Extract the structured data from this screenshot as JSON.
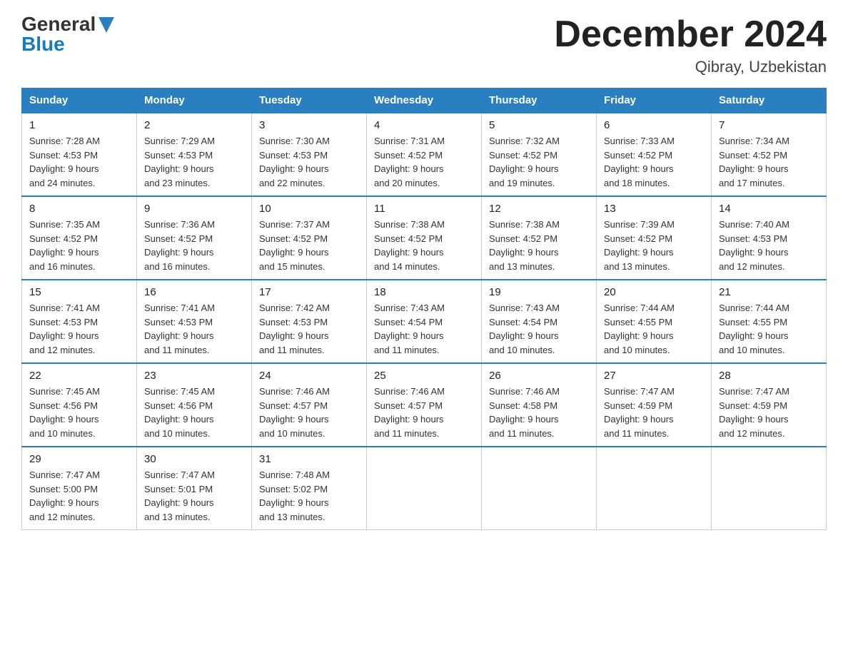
{
  "header": {
    "logo_general": "General",
    "logo_blue": "Blue",
    "month_title": "December 2024",
    "location": "Qibray, Uzbekistan"
  },
  "days_of_week": [
    "Sunday",
    "Monday",
    "Tuesday",
    "Wednesday",
    "Thursday",
    "Friday",
    "Saturday"
  ],
  "weeks": [
    [
      {
        "day": "1",
        "sunrise": "7:28 AM",
        "sunset": "4:53 PM",
        "daylight": "9 hours and 24 minutes."
      },
      {
        "day": "2",
        "sunrise": "7:29 AM",
        "sunset": "4:53 PM",
        "daylight": "9 hours and 23 minutes."
      },
      {
        "day": "3",
        "sunrise": "7:30 AM",
        "sunset": "4:53 PM",
        "daylight": "9 hours and 22 minutes."
      },
      {
        "day": "4",
        "sunrise": "7:31 AM",
        "sunset": "4:52 PM",
        "daylight": "9 hours and 20 minutes."
      },
      {
        "day": "5",
        "sunrise": "7:32 AM",
        "sunset": "4:52 PM",
        "daylight": "9 hours and 19 minutes."
      },
      {
        "day": "6",
        "sunrise": "7:33 AM",
        "sunset": "4:52 PM",
        "daylight": "9 hours and 18 minutes."
      },
      {
        "day": "7",
        "sunrise": "7:34 AM",
        "sunset": "4:52 PM",
        "daylight": "9 hours and 17 minutes."
      }
    ],
    [
      {
        "day": "8",
        "sunrise": "7:35 AM",
        "sunset": "4:52 PM",
        "daylight": "9 hours and 16 minutes."
      },
      {
        "day": "9",
        "sunrise": "7:36 AM",
        "sunset": "4:52 PM",
        "daylight": "9 hours and 16 minutes."
      },
      {
        "day": "10",
        "sunrise": "7:37 AM",
        "sunset": "4:52 PM",
        "daylight": "9 hours and 15 minutes."
      },
      {
        "day": "11",
        "sunrise": "7:38 AM",
        "sunset": "4:52 PM",
        "daylight": "9 hours and 14 minutes."
      },
      {
        "day": "12",
        "sunrise": "7:38 AM",
        "sunset": "4:52 PM",
        "daylight": "9 hours and 13 minutes."
      },
      {
        "day": "13",
        "sunrise": "7:39 AM",
        "sunset": "4:52 PM",
        "daylight": "9 hours and 13 minutes."
      },
      {
        "day": "14",
        "sunrise": "7:40 AM",
        "sunset": "4:53 PM",
        "daylight": "9 hours and 12 minutes."
      }
    ],
    [
      {
        "day": "15",
        "sunrise": "7:41 AM",
        "sunset": "4:53 PM",
        "daylight": "9 hours and 12 minutes."
      },
      {
        "day": "16",
        "sunrise": "7:41 AM",
        "sunset": "4:53 PM",
        "daylight": "9 hours and 11 minutes."
      },
      {
        "day": "17",
        "sunrise": "7:42 AM",
        "sunset": "4:53 PM",
        "daylight": "9 hours and 11 minutes."
      },
      {
        "day": "18",
        "sunrise": "7:43 AM",
        "sunset": "4:54 PM",
        "daylight": "9 hours and 11 minutes."
      },
      {
        "day": "19",
        "sunrise": "7:43 AM",
        "sunset": "4:54 PM",
        "daylight": "9 hours and 10 minutes."
      },
      {
        "day": "20",
        "sunrise": "7:44 AM",
        "sunset": "4:55 PM",
        "daylight": "9 hours and 10 minutes."
      },
      {
        "day": "21",
        "sunrise": "7:44 AM",
        "sunset": "4:55 PM",
        "daylight": "9 hours and 10 minutes."
      }
    ],
    [
      {
        "day": "22",
        "sunrise": "7:45 AM",
        "sunset": "4:56 PM",
        "daylight": "9 hours and 10 minutes."
      },
      {
        "day": "23",
        "sunrise": "7:45 AM",
        "sunset": "4:56 PM",
        "daylight": "9 hours and 10 minutes."
      },
      {
        "day": "24",
        "sunrise": "7:46 AM",
        "sunset": "4:57 PM",
        "daylight": "9 hours and 10 minutes."
      },
      {
        "day": "25",
        "sunrise": "7:46 AM",
        "sunset": "4:57 PM",
        "daylight": "9 hours and 11 minutes."
      },
      {
        "day": "26",
        "sunrise": "7:46 AM",
        "sunset": "4:58 PM",
        "daylight": "9 hours and 11 minutes."
      },
      {
        "day": "27",
        "sunrise": "7:47 AM",
        "sunset": "4:59 PM",
        "daylight": "9 hours and 11 minutes."
      },
      {
        "day": "28",
        "sunrise": "7:47 AM",
        "sunset": "4:59 PM",
        "daylight": "9 hours and 12 minutes."
      }
    ],
    [
      {
        "day": "29",
        "sunrise": "7:47 AM",
        "sunset": "5:00 PM",
        "daylight": "9 hours and 12 minutes."
      },
      {
        "day": "30",
        "sunrise": "7:47 AM",
        "sunset": "5:01 PM",
        "daylight": "9 hours and 13 minutes."
      },
      {
        "day": "31",
        "sunrise": "7:48 AM",
        "sunset": "5:02 PM",
        "daylight": "9 hours and 13 minutes."
      },
      null,
      null,
      null,
      null
    ]
  ],
  "labels": {
    "sunrise": "Sunrise:",
    "sunset": "Sunset:",
    "daylight": "Daylight:"
  }
}
